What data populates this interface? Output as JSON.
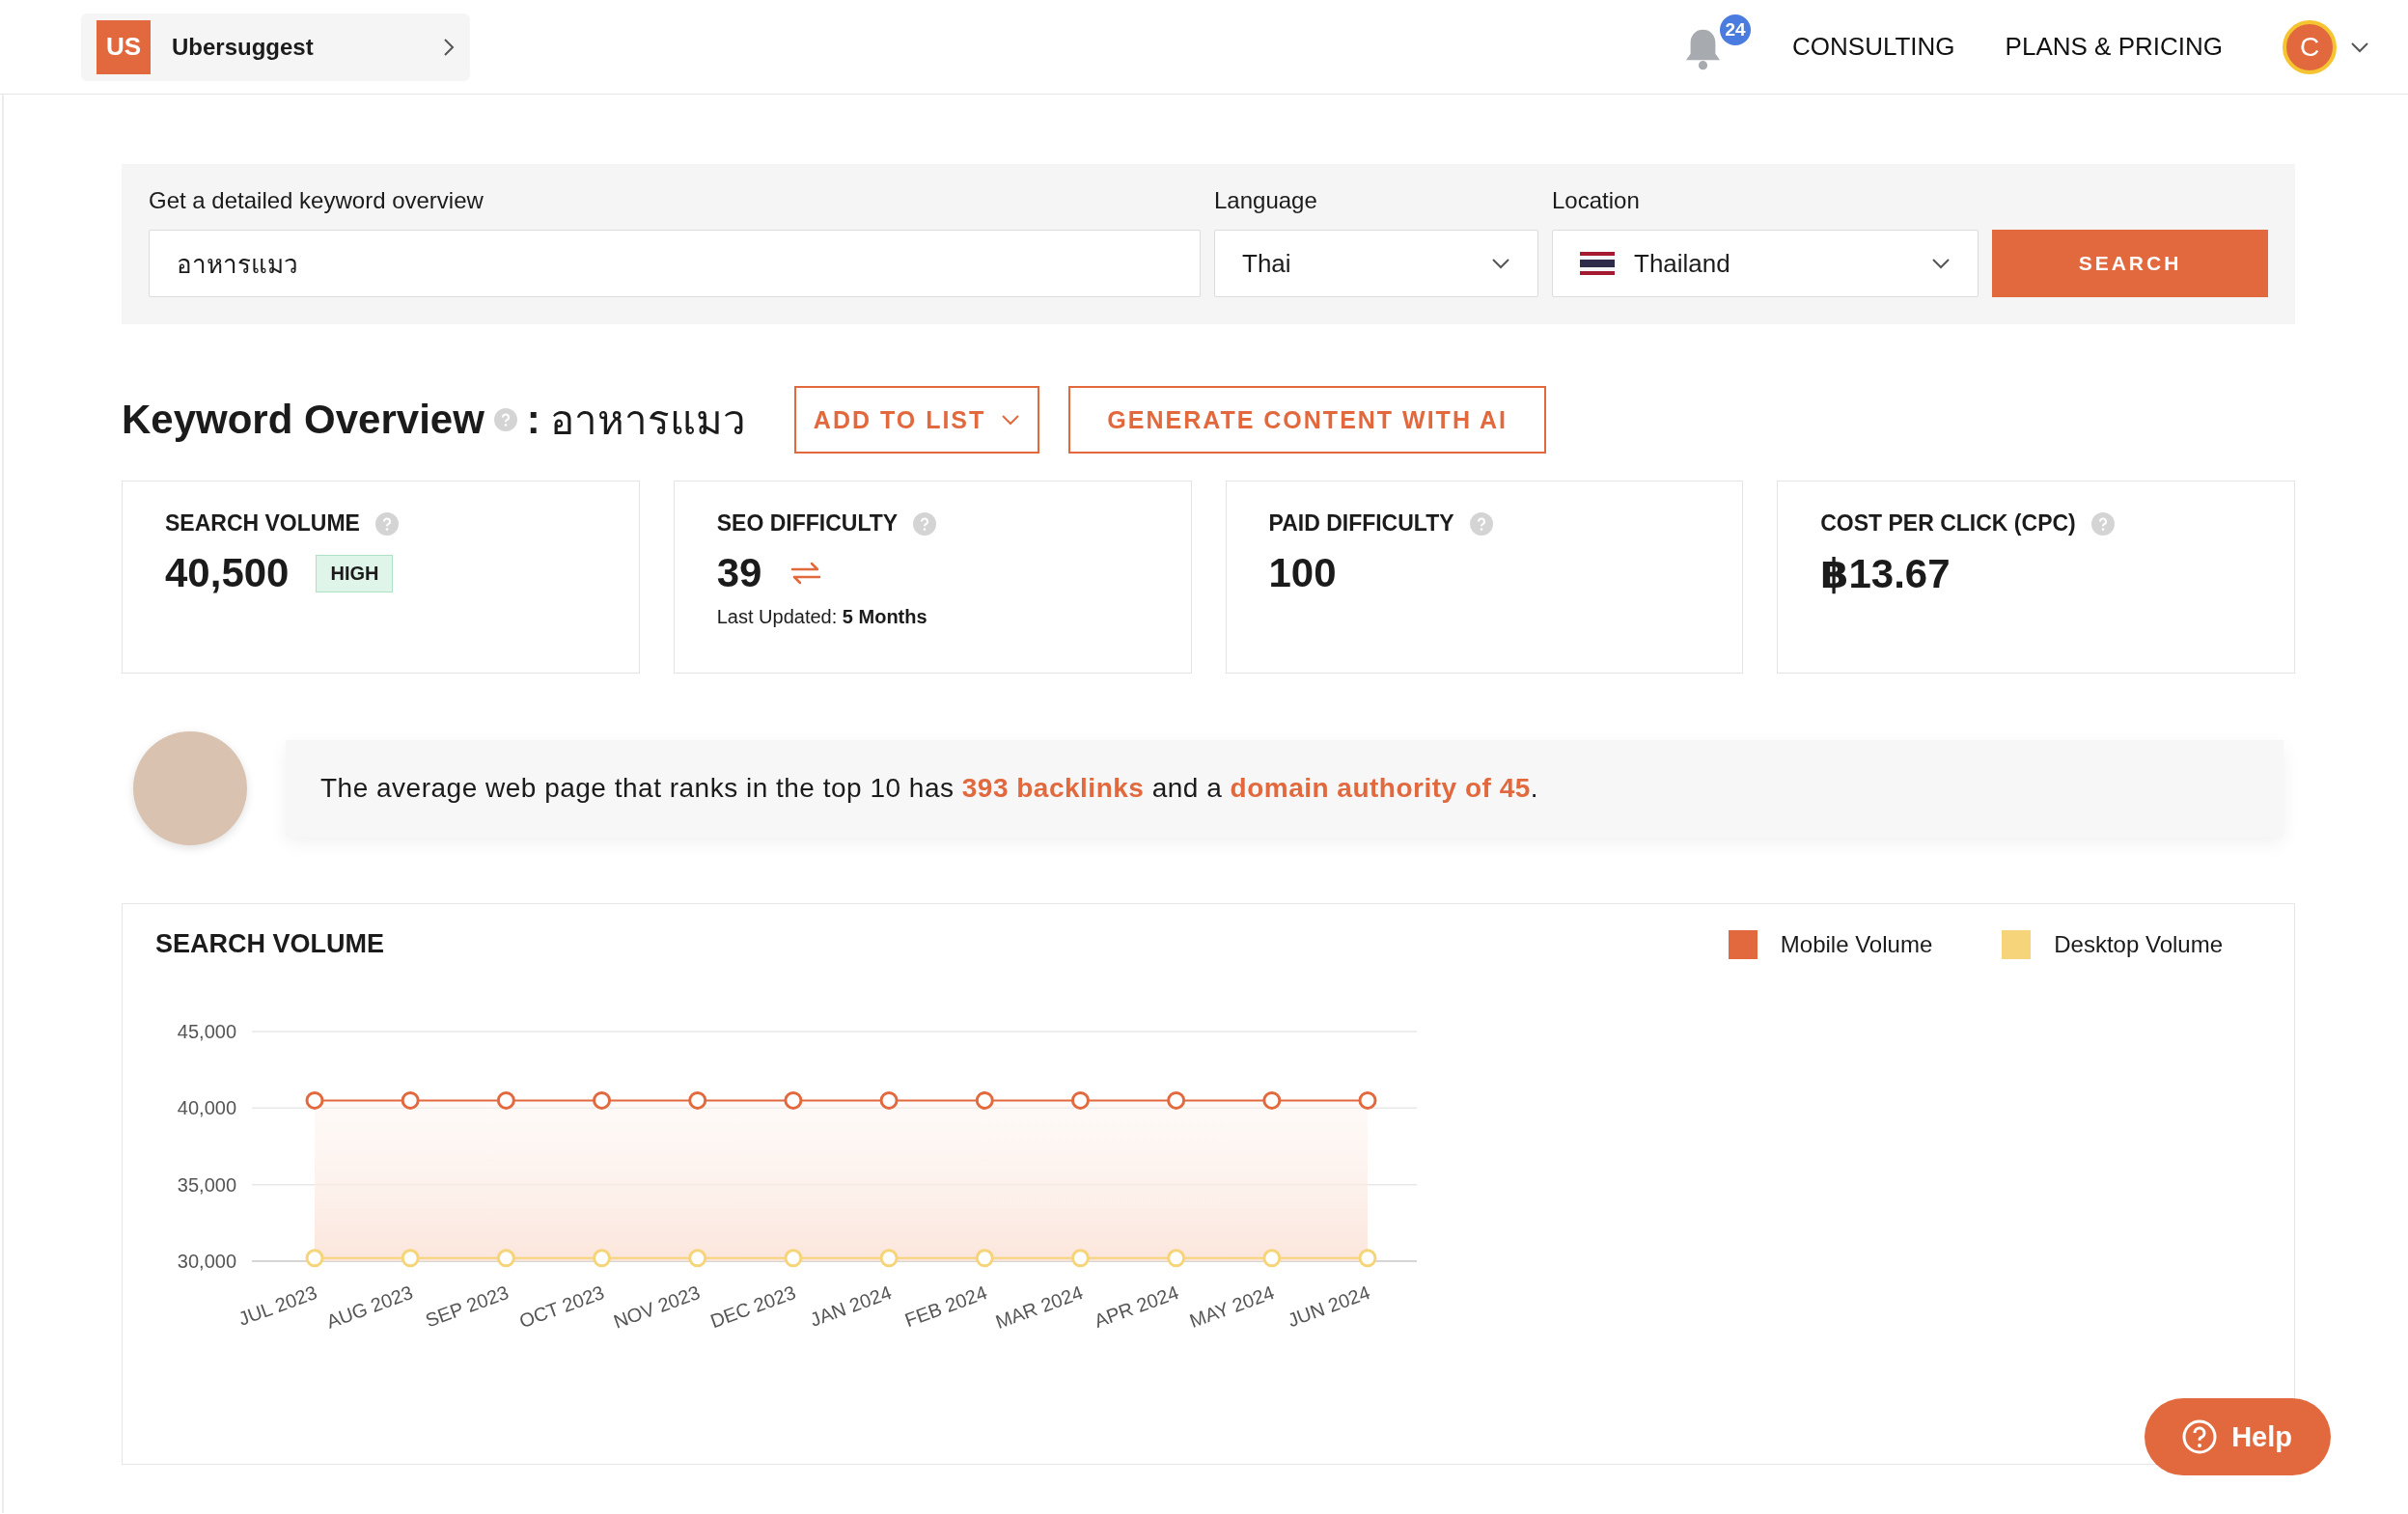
{
  "header": {
    "app_badge": "US",
    "app_name": "Ubersuggest",
    "notifications": "24",
    "nav": [
      "CONSULTING",
      "PLANS & PRICING"
    ],
    "avatar": "C"
  },
  "search": {
    "keyword_label": "Get a detailed keyword overview",
    "keyword_value": "อาหารแมว",
    "language_label": "Language",
    "language": "Thai",
    "location_label": "Location",
    "location": "Thailand",
    "button": "SEARCH"
  },
  "overview": {
    "title": "Keyword Overview",
    "separator": ":",
    "keyword": "อาหารแมว",
    "buttons": [
      {
        "label": "ADD TO LIST",
        "kind": "dropdown"
      },
      {
        "label": "GENERATE CONTENT WITH AI",
        "kind": "plain"
      }
    ]
  },
  "metrics": [
    {
      "kind": "badge",
      "label": "SEARCH VOLUME",
      "value": "40,500",
      "badge": "HIGH"
    },
    {
      "kind": "updated",
      "label": "SEO DIFFICULTY",
      "value": "39",
      "note": "Last Updated: **5 Months**"
    },
    {
      "kind": "plain",
      "label": "PAID DIFFICULTY",
      "value": "100"
    },
    {
      "kind": "plain",
      "label": "COST PER CLICK (CPC)",
      "value": "฿13.67"
    }
  ],
  "tip": {
    "text": "The average web page that ranks in the top 10 has **393 backlinks** and a **domain authority of 45**."
  },
  "volume_chart": {
    "title": "SEARCH VOLUME",
    "chart_data": {
      "type": "area",
      "categories": [
        "JUL 2023",
        "AUG 2023",
        "SEP 2023",
        "OCT 2023",
        "NOV 2023",
        "DEC 2023",
        "JAN 2024",
        "FEB 2024",
        "MAR 2024",
        "APR 2024",
        "MAY 2024",
        "JUN 2024"
      ],
      "series": [
        {
          "name": "Mobile Volume",
          "type": "area",
          "color": "#e2693e",
          "marker": "circle",
          "values": [
            40500,
            40500,
            40500,
            40500,
            40500,
            40500,
            40500,
            40500,
            40500,
            40500,
            40500,
            40500
          ]
        },
        {
          "name": "Desktop Volume",
          "type": "line",
          "color": "#f6d479",
          "marker": "circle",
          "values": [
            30200,
            30200,
            30200,
            30200,
            30200,
            30200,
            30200,
            30200,
            30200,
            30200,
            30200,
            30200
          ]
        }
      ],
      "ylim": [
        30000,
        45000
      ],
      "yticks": [
        {
          "value": 30000,
          "label": "30,000"
        },
        {
          "value": 35000,
          "label": "35,000"
        },
        {
          "value": 40000,
          "label": "40,000"
        },
        {
          "value": 45000,
          "label": "45,000"
        }
      ]
    }
  },
  "help": {
    "label": "Help"
  }
}
